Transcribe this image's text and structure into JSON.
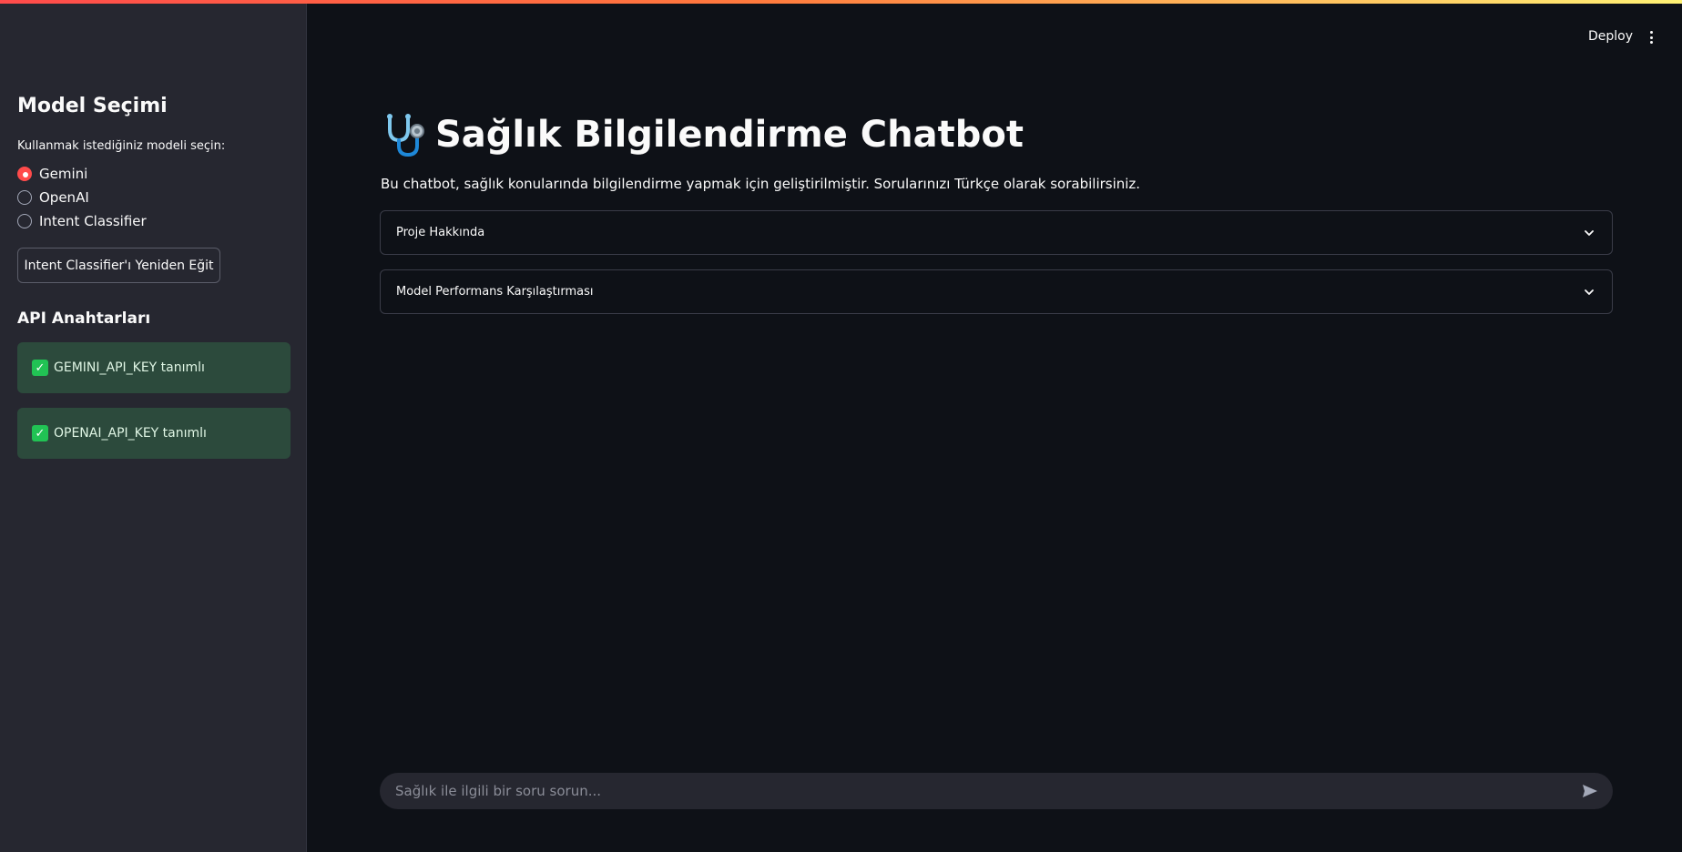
{
  "sidebar": {
    "title": "Model Seçimi",
    "radio_label": "Kullanmak istediğiniz modeli seçin:",
    "models": [
      {
        "label": "Gemini",
        "selected": true
      },
      {
        "label": "OpenAI",
        "selected": false
      },
      {
        "label": "Intent Classifier",
        "selected": false
      }
    ],
    "retrain_button": "Intent Classifier'ı Yeniden Eğit",
    "api_title": "API Anahtarları",
    "api_status": [
      {
        "text": "GEMINI_API_KEY tanımlı"
      },
      {
        "text": "OPENAI_API_KEY tanımlı"
      }
    ]
  },
  "header": {
    "deploy_label": "Deploy"
  },
  "main": {
    "title": "Sağlık Bilgilendirme Chatbot",
    "title_icon": "stethoscope-icon",
    "subtitle": "Bu chatbot, sağlık konularında bilgilendirme yapmak için geliştirilmiştir. Sorularınızı Türkçe olarak sorabilirsiniz.",
    "expanders": [
      {
        "label": "Proje Hakkında"
      },
      {
        "label": "Model Performans Karşılaştırması"
      }
    ],
    "chat_input": {
      "placeholder": "Sağlık ile ilgili bir soru sorun...",
      "value": ""
    }
  },
  "colors": {
    "accent": "#ff4b4b",
    "background": "#0e1117",
    "sidebar": "#262730",
    "success_bg": "#2c4a3c"
  }
}
